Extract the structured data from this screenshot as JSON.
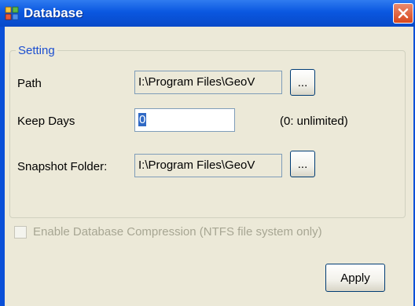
{
  "window": {
    "title": "Database"
  },
  "group": {
    "title": "Setting"
  },
  "path": {
    "label": "Path",
    "value": "I:\\Program Files\\GeoV",
    "browse_label": "..."
  },
  "keep_days": {
    "label": "Keep Days",
    "value": "0",
    "hint": "(0: unlimited)"
  },
  "snapshot": {
    "label": "Snapshot Folder:",
    "value": "I:\\Program Files\\GeoV",
    "browse_label": "..."
  },
  "compression": {
    "label": "Enable Database Compression (NTFS file system only)",
    "checked": false
  },
  "apply_label": "Apply"
}
